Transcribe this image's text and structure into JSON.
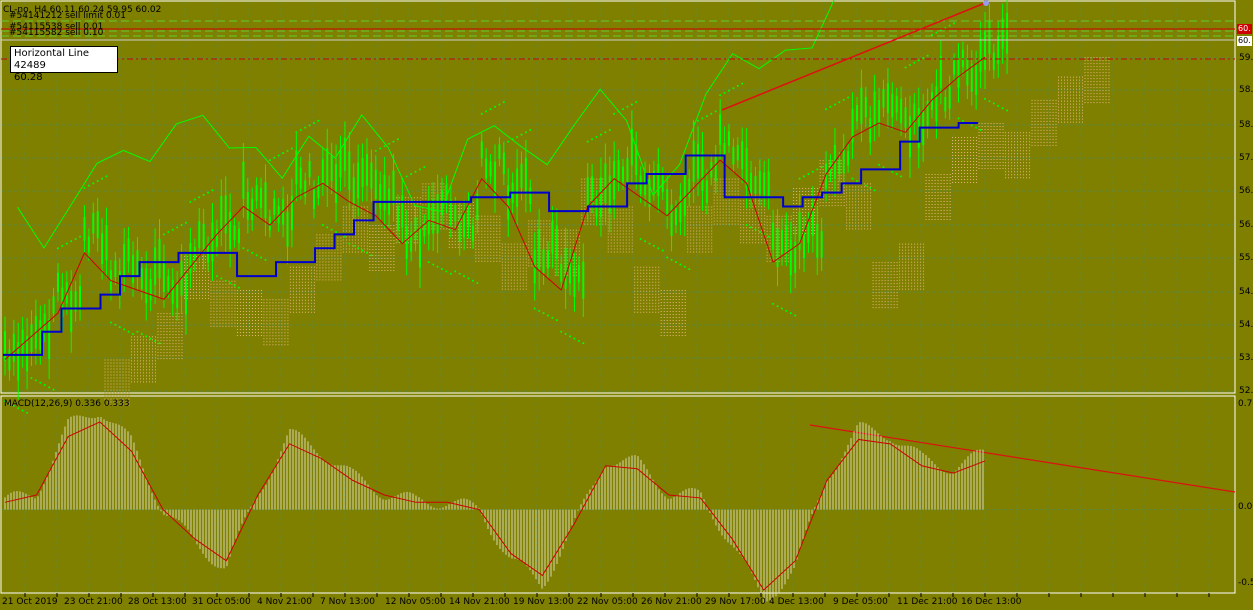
{
  "header": {
    "symbol_line": "CL-no, H4 60.11 60.24 59.95 60.02",
    "order_line_1": "#54141212 sell limit 0.01",
    "order_line_2": "#54115538 sell 0.01",
    "order_line_3": "#54115582 sell 0.10"
  },
  "tooltip": {
    "title": "Horizontal Line 42489",
    "value": "60.28"
  },
  "price_axis": {
    "labels": [
      "59.",
      "58.",
      "58.",
      "57.",
      "56.",
      "56.",
      "55.",
      "54.",
      "54.",
      "53.",
      "52."
    ],
    "tag_red": "60.",
    "tag_white": "60."
  },
  "macd": {
    "title": "MACD(12,26,9) 0.336 0.333",
    "axis_labels": [
      "0.7",
      "0.00",
      "-0.5"
    ]
  },
  "time_axis": {
    "labels": [
      "21 Oct 2019",
      "23 Oct 21:00",
      "28 Oct 13:00",
      "31 Oct 05:00",
      "4 Nov 21:00",
      "7 Nov 13:00",
      "12 Nov 05:00",
      "14 Nov 21:00",
      "19 Nov 13:00",
      "22 Nov 05:00",
      "26 Nov 21:00",
      "29 Nov 17:00",
      "4 Dec 13:00",
      "9 Dec 05:00",
      "11 Dec 21:00",
      "16 Dec 13:00"
    ]
  },
  "colors": {
    "background": "#7f7f00",
    "grid": "#5f8a3a",
    "candles": "#00ff00",
    "kijun": "#0000cc",
    "tenkan": "#cc0000",
    "cloud": "#e8b87a",
    "psar": "#00ff00",
    "macd_hist": "#d8d8b0",
    "signal": "#cc0000",
    "trendline": "#dd1111"
  },
  "chart_data": {
    "type": "line",
    "kijun_line": [
      53.3,
      53.3,
      53.8,
      54.3,
      54.3,
      54.6,
      55.0,
      55.3,
      55.3,
      55.5,
      55.5,
      55.5,
      55.0,
      55.0,
      55.3,
      55.3,
      55.6,
      55.9,
      56.2,
      56.6,
      56.6,
      56.6,
      56.6,
      56.6,
      56.7,
      56.7,
      56.8,
      56.8,
      56.4,
      56.4,
      56.5,
      56.5,
      57.0,
      57.2,
      57.2,
      57.6,
      57.6,
      56.7,
      56.7,
      56.7,
      56.5,
      56.7,
      56.8,
      57.0,
      57.3,
      57.3,
      57.9,
      58.2,
      58.2,
      58.3,
      58.3
    ],
    "price_close": [
      53.5,
      54.0,
      54.5,
      55.8,
      55.2,
      55.0,
      54.8,
      55.5,
      56.2,
      56.8,
      56.4,
      57.0,
      57.3,
      56.9,
      56.6,
      56.0,
      56.5,
      56.3,
      57.4,
      56.8,
      55.5,
      55.0,
      56.8,
      57.4,
      57.0,
      56.6,
      57.2,
      57.8,
      57.3,
      55.6,
      56.0,
      57.5,
      58.3,
      58.6,
      58.4,
      59.1,
      59.6,
      60.02
    ],
    "macd_signal": [
      0.05,
      0.1,
      0.5,
      0.6,
      0.4,
      0.0,
      -0.2,
      -0.35,
      0.1,
      0.45,
      0.35,
      0.2,
      0.1,
      0.05,
      0.05,
      0.0,
      -0.3,
      -0.45,
      -0.1,
      0.3,
      0.28,
      0.1,
      0.08,
      -0.2,
      -0.55,
      -0.35,
      0.2,
      0.48,
      0.45,
      0.3,
      0.25,
      0.333
    ],
    "ylim": [
      52.5,
      60.5
    ],
    "macd_ylim": [
      -0.55,
      0.75
    ]
  }
}
